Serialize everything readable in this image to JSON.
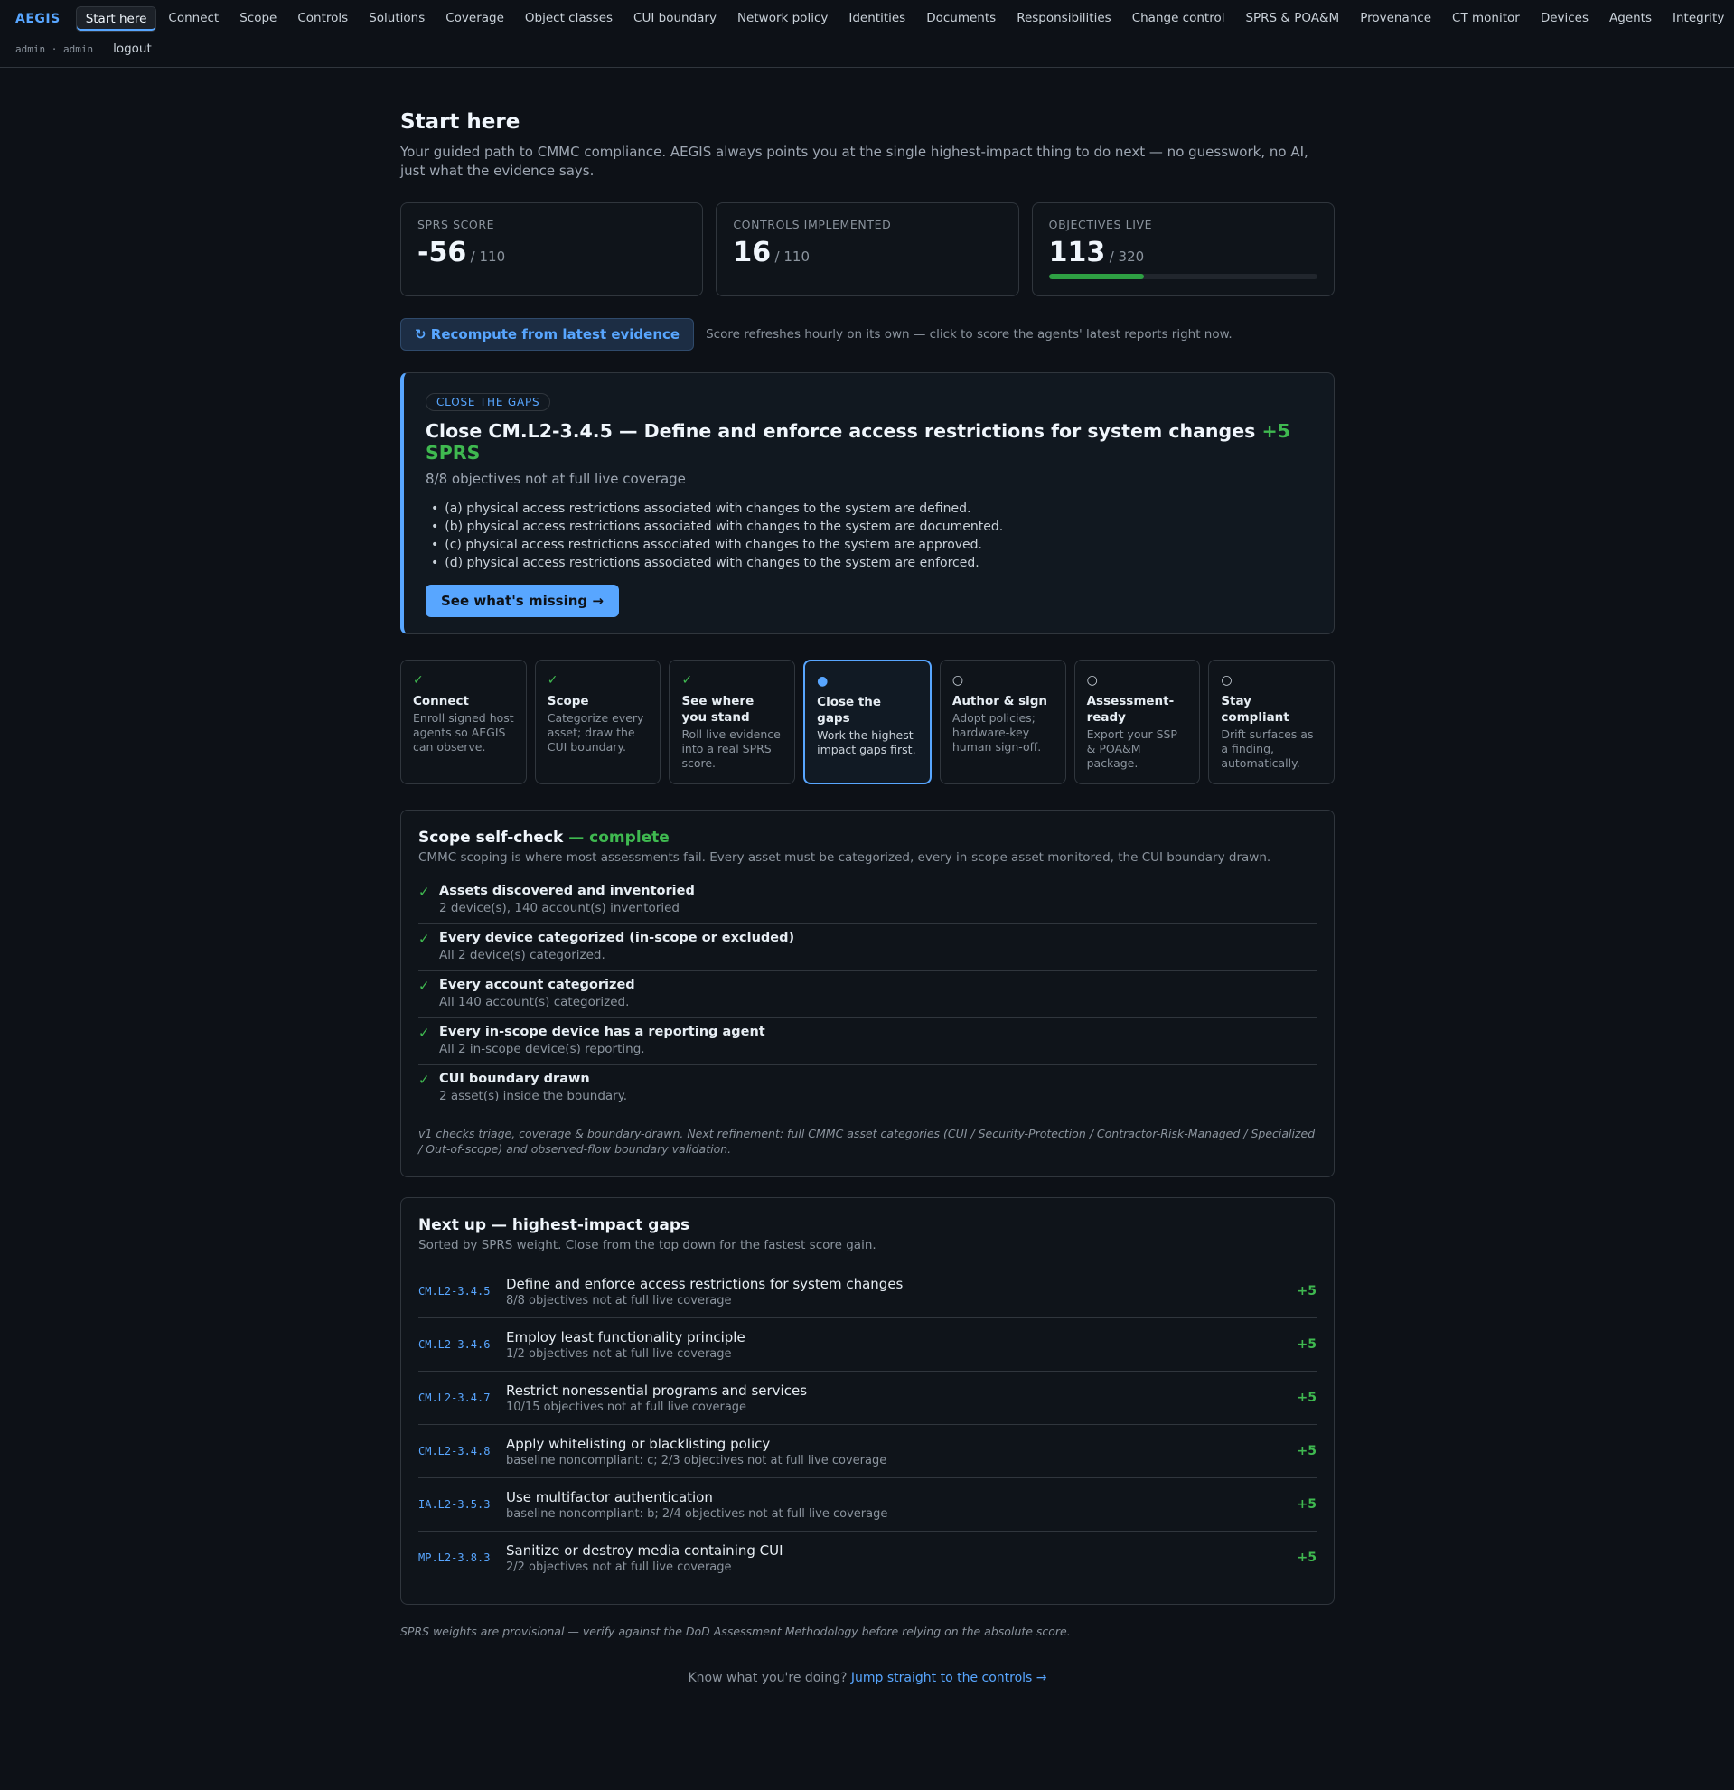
{
  "brand": "AEGIS",
  "nav": [
    "Start here",
    "Connect",
    "Scope",
    "Controls",
    "Solutions",
    "Coverage",
    "Object classes",
    "CUI boundary",
    "Network policy",
    "Identities",
    "Documents",
    "Responsibilities",
    "Change control",
    "SPRS & POA&M",
    "Provenance",
    "CT monitor",
    "Devices",
    "Agents",
    "Integrity"
  ],
  "active_nav": "Start here",
  "user": {
    "ident": "admin · admin",
    "logout": "logout"
  },
  "page": {
    "title": "Start here",
    "subtitle": "Your guided path to CMMC compliance. AEGIS always points you at the single highest-impact thing to do next — no guesswork, no AI, just what the evidence says."
  },
  "stats": [
    {
      "label": "SPRS SCORE",
      "value": "-56",
      "denom": "/ 110"
    },
    {
      "label": "CONTROLS IMPLEMENTED",
      "value": "16",
      "denom": "/ 110"
    },
    {
      "label": "OBJECTIVES LIVE",
      "value": "113",
      "denom": "/ 320",
      "progress": 0.353
    }
  ],
  "recompute": {
    "button": "↻ Recompute from latest evidence",
    "note": "Score refreshes hourly on its own — click to score the agents' latest reports right now."
  },
  "focus": {
    "tag": "CLOSE THE GAPS",
    "title": "Close CM.L2-3.4.5 — Define and enforce access restrictions for system changes",
    "gain": "+5 SPRS",
    "subtitle": "8/8 objectives not at full live coverage",
    "bullets": [
      "(a) physical access restrictions associated with changes to the system are defined.",
      "(b) physical access restrictions associated with changes to the system are documented.",
      "(c) physical access restrictions associated with changes to the system are approved.",
      "(d) physical access restrictions associated with changes to the system are enforced."
    ],
    "button": "See what's missing →"
  },
  "steps": [
    {
      "status": "done",
      "mark": "✓",
      "title": "Connect",
      "desc": "Enroll signed host agents so AEGIS can observe."
    },
    {
      "status": "done",
      "mark": "✓",
      "title": "Scope",
      "desc": "Categorize every asset; draw the CUI boundary."
    },
    {
      "status": "done",
      "mark": "✓",
      "title": "See where you stand",
      "desc": "Roll live evidence into a real SPRS score."
    },
    {
      "status": "current",
      "mark": "●",
      "title": "Close the gaps",
      "desc": "Work the highest-impact gaps first."
    },
    {
      "status": "todo",
      "mark": "○",
      "title": "Author & sign",
      "desc": "Adopt policies; hardware-key human sign-off."
    },
    {
      "status": "todo",
      "mark": "○",
      "title": "Assessment-ready",
      "desc": "Export your SSP & POA&M package."
    },
    {
      "status": "todo",
      "mark": "○",
      "title": "Stay compliant",
      "desc": "Drift surfaces as a finding, automatically."
    }
  ],
  "scope_check": {
    "title": "Scope self-check",
    "status": " — complete",
    "subtitle": "CMMC scoping is where most assessments fail. Every asset must be categorized, every in-scope asset monitored, the CUI boundary drawn.",
    "items": [
      {
        "title": "Assets discovered and inventoried",
        "detail": "2 device(s), 140 account(s) inventoried"
      },
      {
        "title": "Every device categorized (in-scope or excluded)",
        "detail": "All 2 device(s) categorized."
      },
      {
        "title": "Every account categorized",
        "detail": "All 140 account(s) categorized."
      },
      {
        "title": "Every in-scope device has a reporting agent",
        "detail": "All 2 in-scope device(s) reporting."
      },
      {
        "title": "CUI boundary drawn",
        "detail": "2 asset(s) inside the boundary."
      }
    ],
    "note": "v1 checks triage, coverage & boundary-drawn. Next refinement: full CMMC asset categories (CUI / Security-Protection / Contractor-Risk-Managed / Specialized / Out-of-scope) and observed-flow boundary validation."
  },
  "next_up": {
    "title": "Next up — highest-impact gaps",
    "subtitle": "Sorted by SPRS weight. Close from the top down for the fastest score gain.",
    "gaps": [
      {
        "id": "CM.L2-3.4.5",
        "name": "Define and enforce access restrictions for system changes",
        "detail": "8/8 objectives not at full live coverage",
        "gain": "+5"
      },
      {
        "id": "CM.L2-3.4.6",
        "name": "Employ least functionality principle",
        "detail": "1/2 objectives not at full live coverage",
        "gain": "+5"
      },
      {
        "id": "CM.L2-3.4.7",
        "name": "Restrict nonessential programs and services",
        "detail": "10/15 objectives not at full live coverage",
        "gain": "+5"
      },
      {
        "id": "CM.L2-3.4.8",
        "name": "Apply whitelisting or blacklisting policy",
        "detail": "baseline noncompliant: c; 2/3 objectives not at full live coverage",
        "gain": "+5"
      },
      {
        "id": "IA.L2-3.5.3",
        "name": "Use multifactor authentication",
        "detail": "baseline noncompliant: b; 2/4 objectives not at full live coverage",
        "gain": "+5"
      },
      {
        "id": "MP.L2-3.8.3",
        "name": "Sanitize or destroy media containing CUI",
        "detail": "2/2 objectives not at full live coverage",
        "gain": "+5"
      }
    ]
  },
  "disclaimer": "SPRS weights are provisional — verify against the DoD Assessment Methodology before relying on the absolute score.",
  "footer": {
    "prefix": "Know what you're doing? ",
    "link": "Jump straight to the controls →"
  }
}
